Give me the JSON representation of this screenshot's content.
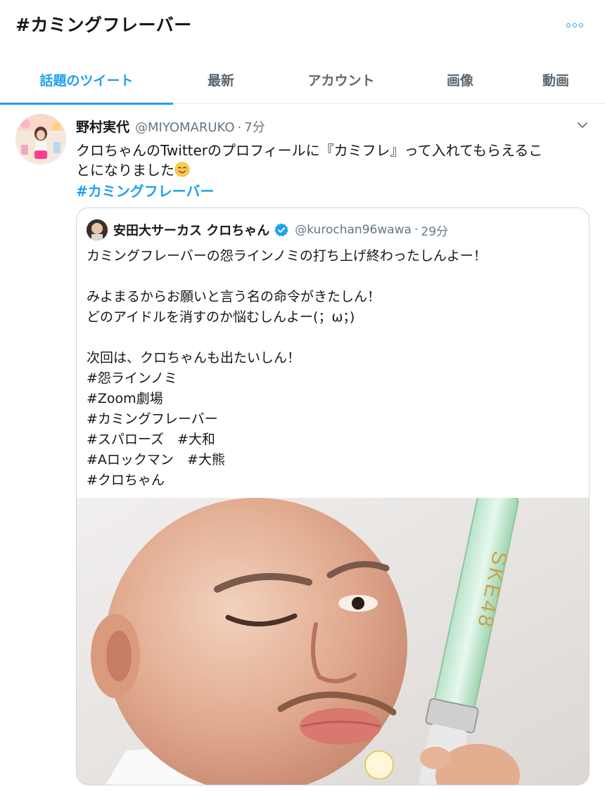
{
  "header": {
    "title": "#カミングフレーバー"
  },
  "tabs": [
    {
      "label": "話題のツイート",
      "active": true
    },
    {
      "label": "最新",
      "active": false
    },
    {
      "label": "アカウント",
      "active": false
    },
    {
      "label": "画像",
      "active": false
    },
    {
      "label": "動画",
      "active": false
    }
  ],
  "tweet": {
    "display_name": "野村実代",
    "handle": "@MIYOMARUKO",
    "separator": "·",
    "time": "7分",
    "text_line1": "クロちゃんのTwitterのプロフィールに『カミフレ』って入れてもらえるこ",
    "text_line2": "とになりました",
    "hashtag": "#カミングフレーバー",
    "quote": {
      "display_name": "安田大サーカス クロちゃん",
      "handle": "@kurochan96wawa",
      "separator": "·",
      "time": "29分",
      "lines": [
        "カミングフレーバーの怨ラインノミの打ち上げ終わったしんよー！",
        "",
        "みよまるからお願いと言う名の命令がきたしん！",
        "どのアイドルを消すのか悩むしんよー(；ω；)",
        "",
        "次回は、クロちゃんも出たいしん！",
        "#怨ラインノミ",
        "#Zoom劇場",
        "#カミングフレーバー",
        "#スパローズ　#大和",
        "#Aロックマン　#大熊",
        "#クロちゃん"
      ],
      "photo_text": "SKE48"
    }
  },
  "colors": {
    "accent": "#1da1f2",
    "text": "#14171a",
    "secondary": "#657786",
    "border": "#ccd6dd"
  },
  "icons": {
    "more": "more-dots-icon",
    "caret": "chevron-down-icon",
    "verified": "verified-badge-icon",
    "emoji": "smiling-face-emoji-icon"
  }
}
